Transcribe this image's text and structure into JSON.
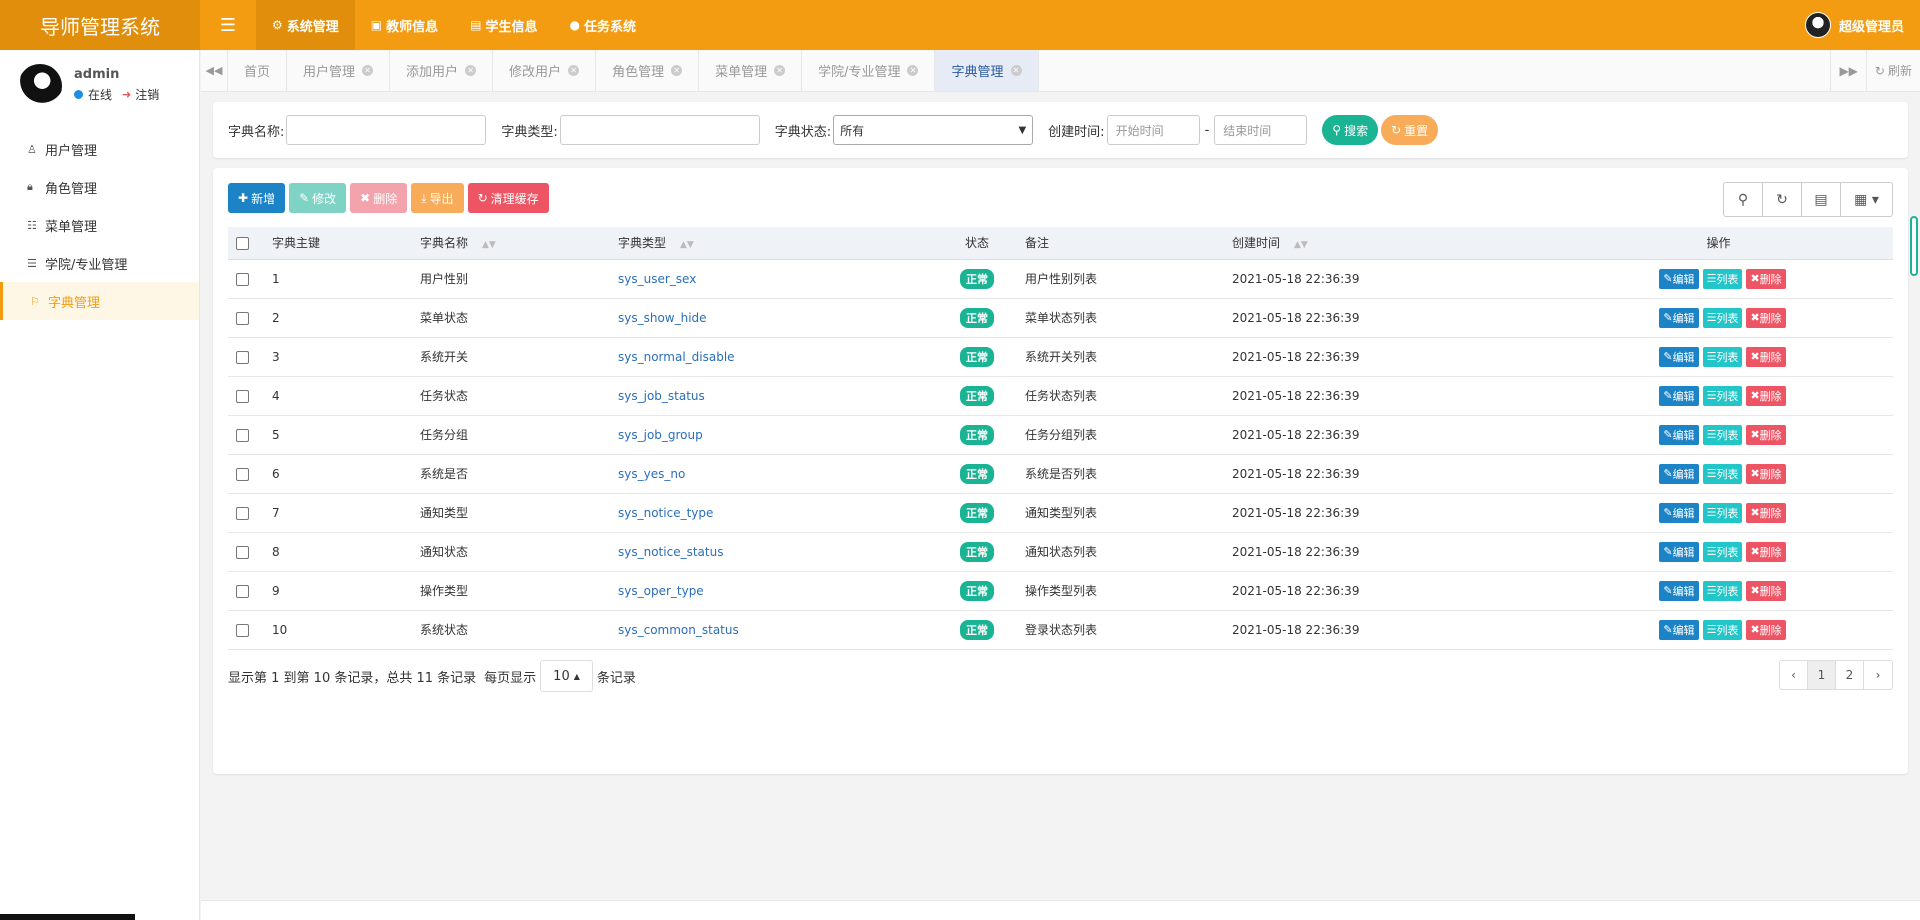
{
  "app": {
    "title": "导师管理系统",
    "admin_name": "超级管理员"
  },
  "topnav": [
    {
      "label": "系统管理",
      "icon": "gear-icon"
    },
    {
      "label": "教师信息",
      "icon": "user-card-icon"
    },
    {
      "label": "学生信息",
      "icon": "id-card-icon"
    },
    {
      "label": "任务系统",
      "icon": "drop-icon"
    }
  ],
  "user": {
    "name": "admin",
    "status": "在线",
    "logout": "注销"
  },
  "sidebar": {
    "items": [
      {
        "label": "用户管理",
        "icon": "user-icon"
      },
      {
        "label": "角色管理",
        "icon": "lock-icon"
      },
      {
        "label": "菜单管理",
        "icon": "list-icon"
      },
      {
        "label": "学院/专业管理",
        "icon": "list-alt-icon"
      },
      {
        "label": "字典管理",
        "icon": "bookmark-icon"
      }
    ]
  },
  "tabs": [
    {
      "label": "首页"
    },
    {
      "label": "用户管理"
    },
    {
      "label": "添加用户"
    },
    {
      "label": "修改用户"
    },
    {
      "label": "角色管理"
    },
    {
      "label": "菜单管理"
    },
    {
      "label": "学院/专业管理"
    },
    {
      "label": "字典管理"
    }
  ],
  "tabbar": {
    "refresh": "刷新"
  },
  "search": {
    "name_label": "字典名称:",
    "type_label": "字典类型:",
    "status_label": "字典状态:",
    "status_value": "所有",
    "time_label": "创建时间:",
    "start_placeholder": "开始时间",
    "end_placeholder": "结束时间",
    "dash": "-",
    "search_btn": "搜索",
    "reset_btn": "重置"
  },
  "toolbar": {
    "add": "新增",
    "edit": "修改",
    "delete": "删除",
    "export": "导出",
    "clear_cache": "清理缓存"
  },
  "table": {
    "headers": [
      "字典主键",
      "字典名称",
      "字典类型",
      "状态",
      "备注",
      "创建时间",
      "操作"
    ],
    "rows": [
      {
        "id": "1",
        "name": "用户性别",
        "type": "sys_user_sex",
        "status": "正常",
        "remark": "用户性别列表",
        "time": "2021-05-18 22:36:39"
      },
      {
        "id": "2",
        "name": "菜单状态",
        "type": "sys_show_hide",
        "status": "正常",
        "remark": "菜单状态列表",
        "time": "2021-05-18 22:36:39"
      },
      {
        "id": "3",
        "name": "系统开关",
        "type": "sys_normal_disable",
        "status": "正常",
        "remark": "系统开关列表",
        "time": "2021-05-18 22:36:39"
      },
      {
        "id": "4",
        "name": "任务状态",
        "type": "sys_job_status",
        "status": "正常",
        "remark": "任务状态列表",
        "time": "2021-05-18 22:36:39"
      },
      {
        "id": "5",
        "name": "任务分组",
        "type": "sys_job_group",
        "status": "正常",
        "remark": "任务分组列表",
        "time": "2021-05-18 22:36:39"
      },
      {
        "id": "6",
        "name": "系统是否",
        "type": "sys_yes_no",
        "status": "正常",
        "remark": "系统是否列表",
        "time": "2021-05-18 22:36:39"
      },
      {
        "id": "7",
        "name": "通知类型",
        "type": "sys_notice_type",
        "status": "正常",
        "remark": "通知类型列表",
        "time": "2021-05-18 22:36:39"
      },
      {
        "id": "8",
        "name": "通知状态",
        "type": "sys_notice_status",
        "status": "正常",
        "remark": "通知状态列表",
        "time": "2021-05-18 22:36:39"
      },
      {
        "id": "9",
        "name": "操作类型",
        "type": "sys_oper_type",
        "status": "正常",
        "remark": "操作类型列表",
        "time": "2021-05-18 22:36:39"
      },
      {
        "id": "10",
        "name": "系统状态",
        "type": "sys_common_status",
        "status": "正常",
        "remark": "登录状态列表",
        "time": "2021-05-18 22:36:39"
      }
    ],
    "actions": {
      "edit": "编辑",
      "list": "列表",
      "delete": "删除"
    }
  },
  "pagination": {
    "info": "显示第 1 到第 10 条记录，总共 11 条记录",
    "per_page_prefix": "每页显示",
    "page_size": "10",
    "per_page_suffix": "条记录",
    "prev": "‹",
    "pages": [
      "1",
      "2"
    ],
    "next": "›"
  },
  "colors": {
    "brand": "#f39c12",
    "primary": "#1c84c6",
    "success": "#1ab394",
    "danger": "#ed5565",
    "warning": "#f8ac59"
  }
}
